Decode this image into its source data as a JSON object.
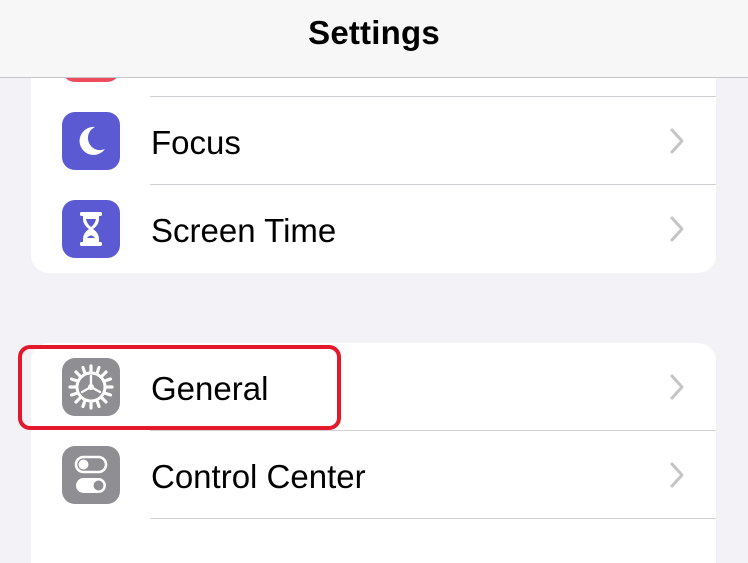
{
  "nav": {
    "title": "Settings"
  },
  "groups": [
    {
      "items": [
        {
          "label": "Focus",
          "icon": "moon-icon",
          "color": "#5b5ad3"
        },
        {
          "label": "Screen Time",
          "icon": "hourglass-icon",
          "color": "#5b5ad3"
        }
      ]
    },
    {
      "items": [
        {
          "label": "General",
          "icon": "gear-icon",
          "color": "#8e8e93",
          "highlighted": true
        },
        {
          "label": "Control Center",
          "icon": "toggles-icon",
          "color": "#8e8e93"
        }
      ]
    }
  ],
  "colors": {
    "highlight": "#e3182a",
    "chevron": "#c4c4c7"
  }
}
